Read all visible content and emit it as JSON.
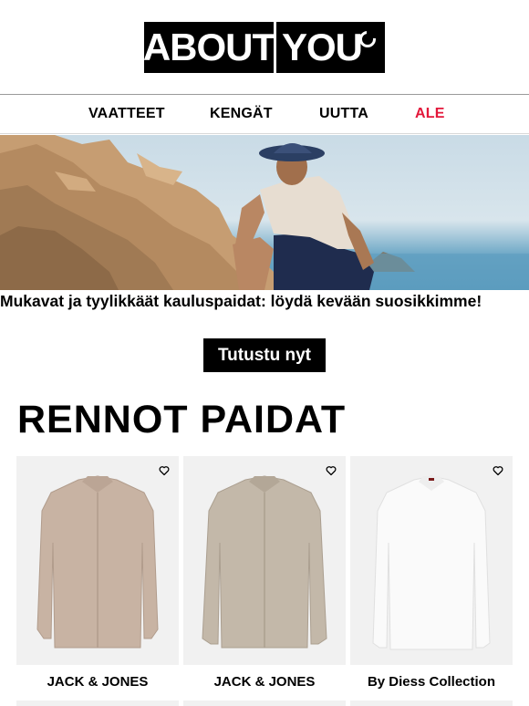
{
  "logo": {
    "part1": "ABOUT",
    "part2": "YOU"
  },
  "nav": [
    {
      "label": "VAATTEET"
    },
    {
      "label": "KENGÄT"
    },
    {
      "label": "UUTTA"
    },
    {
      "label": "ALE",
      "color": "#e3173a"
    }
  ],
  "hero": {
    "headline": "Mukavat ja tyylikkäät kauluspaidat: löydä kevään suosikkimme!",
    "cta": "Tutustu nyt"
  },
  "section": {
    "title": "RENNOT PAIDAT"
  },
  "products": [
    {
      "brand": "JACK & JONES",
      "shirt_color": "#c8b3a3"
    },
    {
      "brand": "JACK & JONES",
      "shirt_color": "#c3b8a9"
    },
    {
      "brand": "By Diess Collection",
      "shirt_color": "#fafafa"
    }
  ],
  "colors": {
    "accent_sale": "#e3173a",
    "brand_black": "#000000",
    "card_bg": "#f1f1f1"
  },
  "icons": {
    "favorite": "heart-outline-icon"
  }
}
